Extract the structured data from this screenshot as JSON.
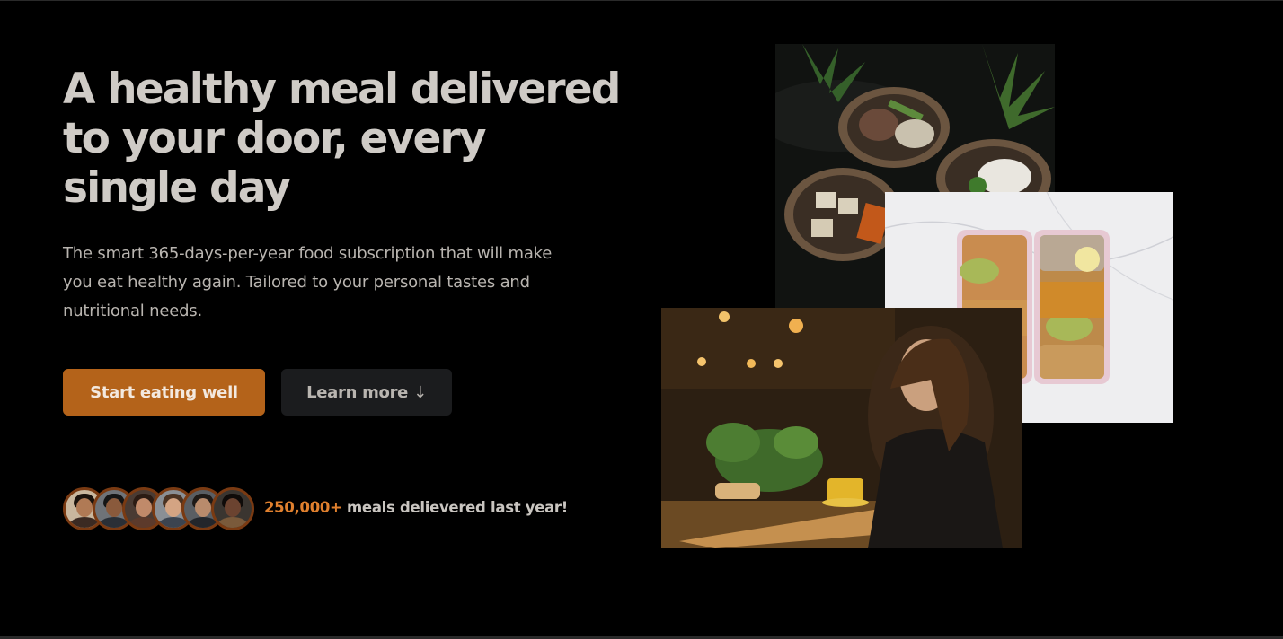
{
  "hero": {
    "headline": "A healthy meal delivered to your door, every single day",
    "description": "The smart 365-days-per-year food subscription that will make you eat healthy again. Tailored to your personal tastes and nutritional needs.",
    "primary_button_label": "Start eating well",
    "secondary_button_label": "Learn more",
    "secondary_button_icon": "down-arrow-icon",
    "secondary_button_arrow": "↓",
    "customers": {
      "meals_count": "250,000+",
      "meals_label": "meals delievered last year!",
      "avatar_names": [
        "customer-1",
        "customer-2",
        "customer-3",
        "customer-4",
        "customer-5",
        "customer-6"
      ]
    }
  },
  "colors": {
    "background": "#000000",
    "headline": "#cfcbc6",
    "body_text": "#b9b5b0",
    "primary_button": "#b4631a",
    "secondary_button": "#1b1c1e",
    "accent": "#e0802e"
  },
  "images": {
    "bowls": "food bowls photo",
    "meal_prep": "meal prep boxes photo",
    "woman": "woman eating photo"
  }
}
